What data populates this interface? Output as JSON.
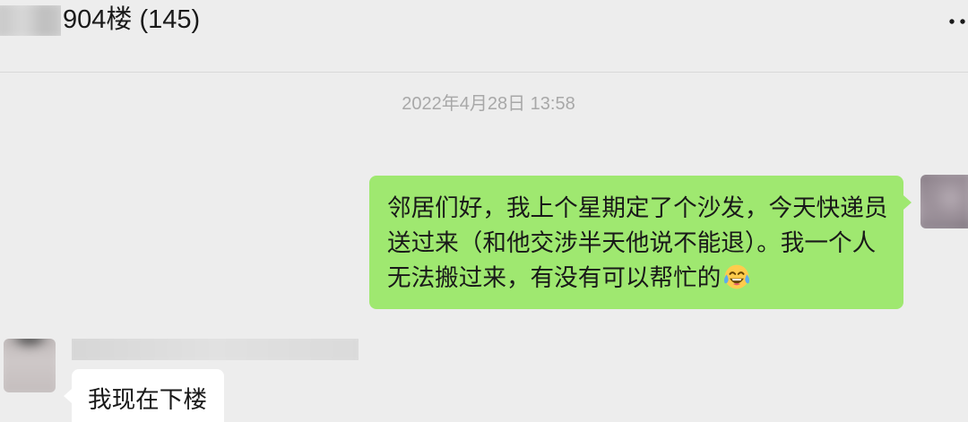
{
  "header": {
    "title": "904楼 (145)",
    "more_icon": "more-dots-icon"
  },
  "chat": {
    "timestamp": "2022年4月28日 13:58",
    "outgoing_message": {
      "text": "邻居们好，我上个星期定了个沙发，今天快递员送过来（和他交涉半天他说不能退）。我一个人无法搬过来，有没有可以帮忙的",
      "emoji_icon": "face-with-tears-of-joy-icon"
    },
    "incoming_message": {
      "text": "我现在下楼"
    }
  },
  "colors": {
    "background": "#ededed",
    "outgoing_bubble": "#9fe870",
    "incoming_bubble": "#ffffff",
    "timestamp_text": "#a8a8a8",
    "message_text": "#191919"
  }
}
